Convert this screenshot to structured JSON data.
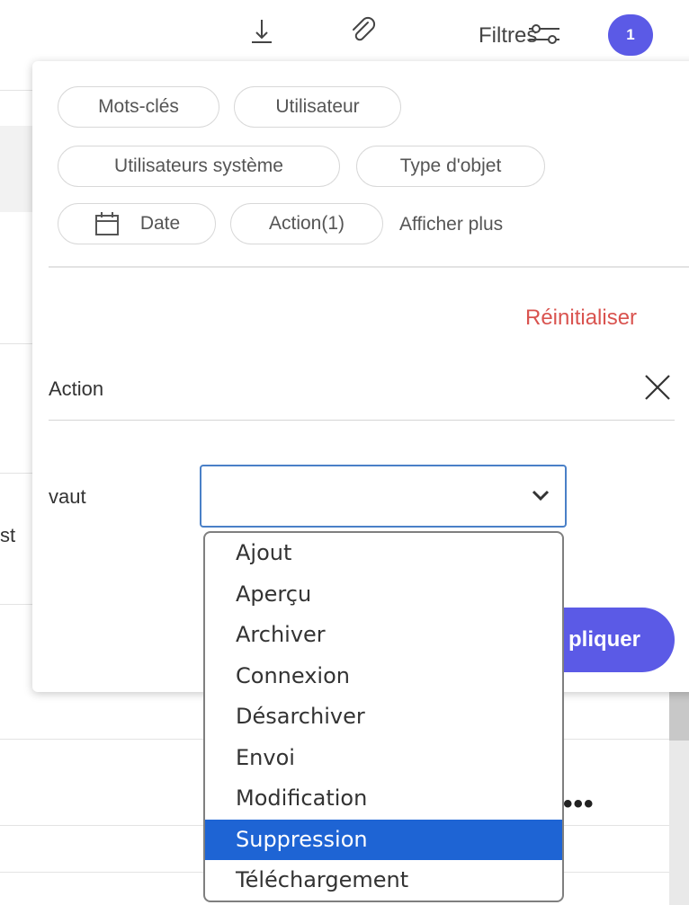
{
  "toolbar": {
    "download_icon": "download-icon",
    "attach_icon": "paperclip-icon",
    "filters_label": "Filtres",
    "filters_icon": "sliders-icon",
    "badge_count": "1"
  },
  "chips": {
    "keywords": "Mots-clés",
    "user": "Utilisateur",
    "system_users": "Utilisateurs système",
    "object_type": "Type d'objet",
    "date": "Date",
    "action": "Action(1)",
    "show_more": "Afficher plus"
  },
  "panel": {
    "reset": "Réinitialiser",
    "section_title": "Action",
    "operator_label": "vaut",
    "select_value": "",
    "apply_label": "pliquer"
  },
  "dropdown": {
    "options": [
      "Ajout",
      "Aperçu",
      "Archiver",
      "Connexion",
      "Désarchiver",
      "Envoi",
      "Modification",
      "Suppression",
      "Téléchargement"
    ],
    "selected": "Suppression"
  },
  "background": {
    "partial_text": "st",
    "row_menu": "•••"
  },
  "colors": {
    "accent": "#5b5ae6",
    "reset": "#d9534f",
    "selected_option": "#1e64d4",
    "select_border": "#4a80c7"
  }
}
